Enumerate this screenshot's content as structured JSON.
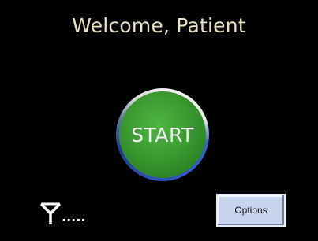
{
  "screen": {
    "welcome_text": "Welcome, Patient"
  },
  "start_button": {
    "label": "START",
    "fill_color": "#3a9a30",
    "ring_color": "#2a4fb8"
  },
  "status": {
    "signal_icon": "antenna-signal-icon",
    "signal_dots": "....."
  },
  "options_button": {
    "label": "Options"
  }
}
